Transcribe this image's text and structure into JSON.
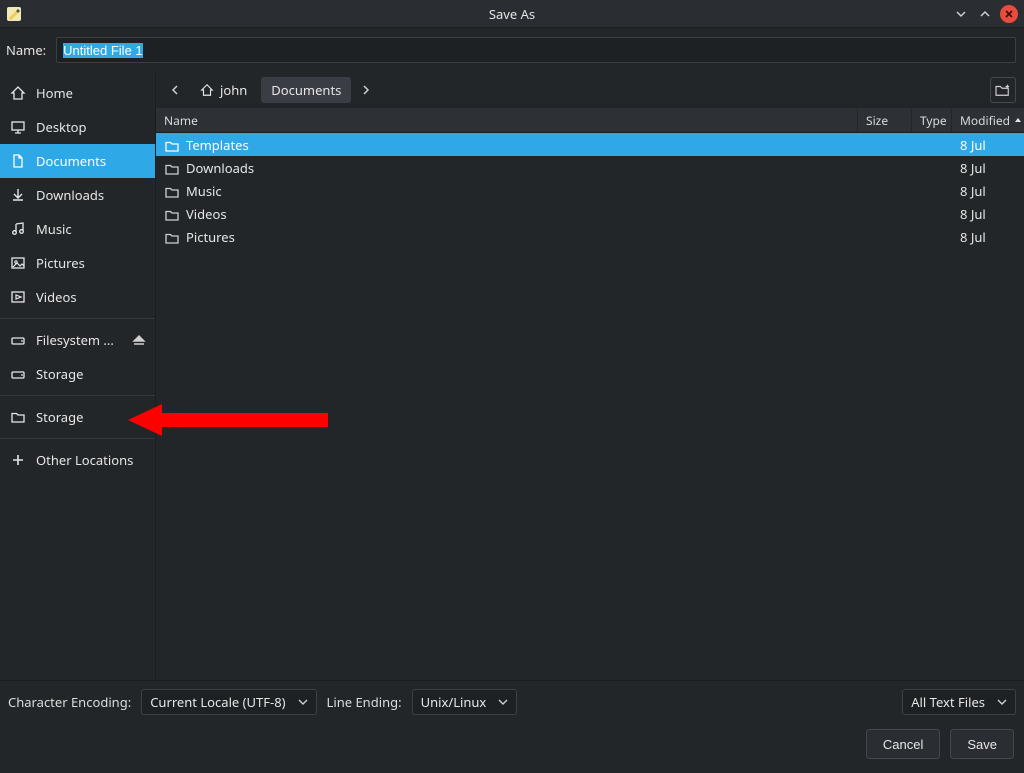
{
  "title": "Save As",
  "name_label": "Name:",
  "filename_value": "Untitled File 1",
  "sidebar": {
    "items": [
      {
        "icon": "home",
        "label": "Home"
      },
      {
        "icon": "desktop",
        "label": "Desktop"
      },
      {
        "icon": "documents",
        "label": "Documents",
        "active": true
      },
      {
        "icon": "downloads",
        "label": "Downloads"
      },
      {
        "icon": "music",
        "label": "Music"
      },
      {
        "icon": "pictures",
        "label": "Pictures"
      },
      {
        "icon": "videos",
        "label": "Videos"
      }
    ],
    "devices": [
      {
        "icon": "drive",
        "label": "Filesystem ...",
        "eject": true
      },
      {
        "icon": "drive",
        "label": "Storage"
      }
    ],
    "bookmarks": [
      {
        "icon": "folder",
        "label": "Storage"
      }
    ],
    "other": {
      "icon": "plus",
      "label": "Other Locations"
    }
  },
  "breadcrumb": {
    "home_user": "john",
    "parts": [
      "Documents"
    ]
  },
  "columns": {
    "name": "Name",
    "size": "Size",
    "type": "Type",
    "modified": "Modified"
  },
  "files": [
    {
      "name": "Templates",
      "size": "",
      "type": "",
      "modified": "8 Jul",
      "selected": true
    },
    {
      "name": "Downloads",
      "size": "",
      "type": "",
      "modified": "8 Jul"
    },
    {
      "name": "Music",
      "size": "",
      "type": "",
      "modified": "8 Jul"
    },
    {
      "name": "Videos",
      "size": "",
      "type": "",
      "modified": "8 Jul"
    },
    {
      "name": "Pictures",
      "size": "",
      "type": "",
      "modified": "8 Jul"
    }
  ],
  "footer": {
    "encoding_label": "Character Encoding:",
    "encoding_value": "Current Locale (UTF-8)",
    "line_ending_label": "Line Ending:",
    "line_ending_value": "Unix/Linux",
    "filter": "All Text Files",
    "cancel": "Cancel",
    "save": "Save"
  }
}
